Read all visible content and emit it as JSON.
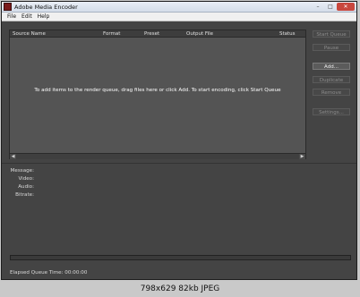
{
  "window": {
    "title": "Adobe Media Encoder",
    "controls": [
      "–",
      "□",
      "✕"
    ]
  },
  "menu": [
    "File",
    "Edit",
    "Help"
  ],
  "queue": {
    "columns": [
      "Source Name",
      "Format",
      "Preset",
      "Output File",
      "Status"
    ],
    "hint": "To add items to the render queue, drag files here or click Add. To start encoding, click Start Queue"
  },
  "buttons": {
    "start_queue": "Start Queue",
    "pause": "Pause",
    "add": "Add...",
    "duplicate": "Duplicate",
    "remove": "Remove",
    "settings": "Settings..."
  },
  "info": {
    "message": "Message:",
    "video": "Video:",
    "audio": "Audio:",
    "bitrate": "Bitrate:"
  },
  "progress": {
    "value": 0
  },
  "elapsed": {
    "label": "Elapsed Queue Time:",
    "value": "00:00:00"
  },
  "caption": "798x629 82kb JPEG"
}
